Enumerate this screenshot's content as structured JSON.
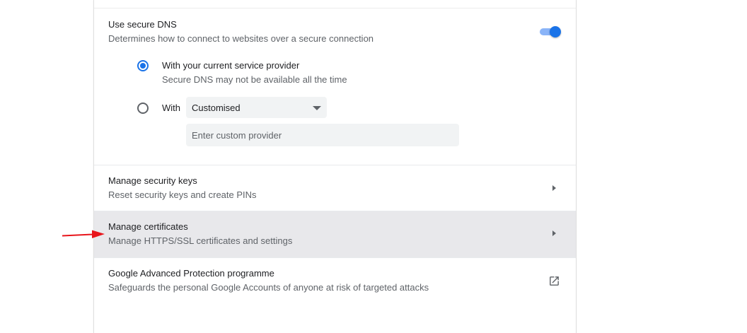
{
  "secure_dns": {
    "title": "Use secure DNS",
    "description": "Determines how to connect to websites over a secure connection",
    "toggle_on": true,
    "option_current": {
      "label": "With your current service provider",
      "sublabel": "Secure DNS may not be available all the time",
      "selected": true
    },
    "option_with": {
      "label": "With",
      "selected": false,
      "dropdown_value": "Customised",
      "custom_provider_placeholder": "Enter custom provider"
    }
  },
  "rows": [
    {
      "title": "Manage security keys",
      "subtitle": "Reset security keys and create PINs",
      "icon": "arrow-right-icon"
    },
    {
      "title": "Manage certificates",
      "subtitle": "Manage HTTPS/SSL certificates and settings",
      "icon": "arrow-right-icon",
      "highlighted": true
    },
    {
      "title": "Google Advanced Protection programme",
      "subtitle": "Safeguards the personal Google Accounts of anyone at risk of targeted attacks",
      "icon": "open-in-new-icon"
    }
  ],
  "colors": {
    "accent": "#1a73e8",
    "toggle_track": "#8ab4f8",
    "highlight_row": "#e8e8eb",
    "annotation_arrow": "#e8151b"
  }
}
